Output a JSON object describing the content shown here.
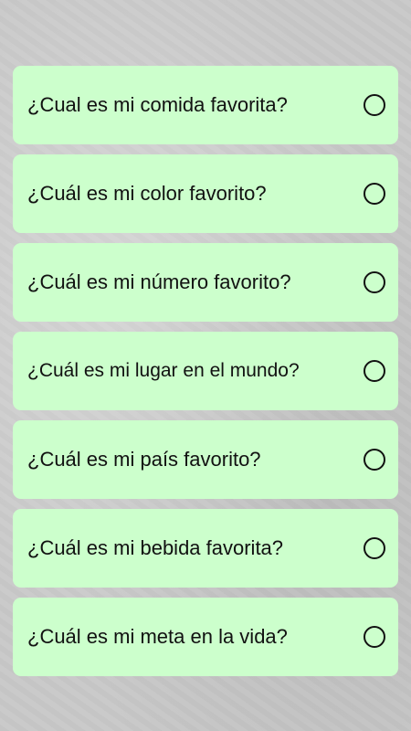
{
  "questions": [
    {
      "label": "¿Cual es mi comida favorita?",
      "selected": false
    },
    {
      "label": "¿Cuál es mi color favorito?",
      "selected": false
    },
    {
      "label": "¿Cuál es mi número favorito?",
      "selected": false
    },
    {
      "label": "¿Cuál es mi lugar en el mundo?",
      "selected": false
    },
    {
      "label": "¿Cuál es mi país favorito?",
      "selected": false
    },
    {
      "label": "¿Cuál es mi bebida favorita?",
      "selected": false
    },
    {
      "label": "¿Cuál es mi meta en la vida?",
      "selected": false
    }
  ],
  "colors": {
    "card": "#ccffcc",
    "text": "#111111"
  }
}
